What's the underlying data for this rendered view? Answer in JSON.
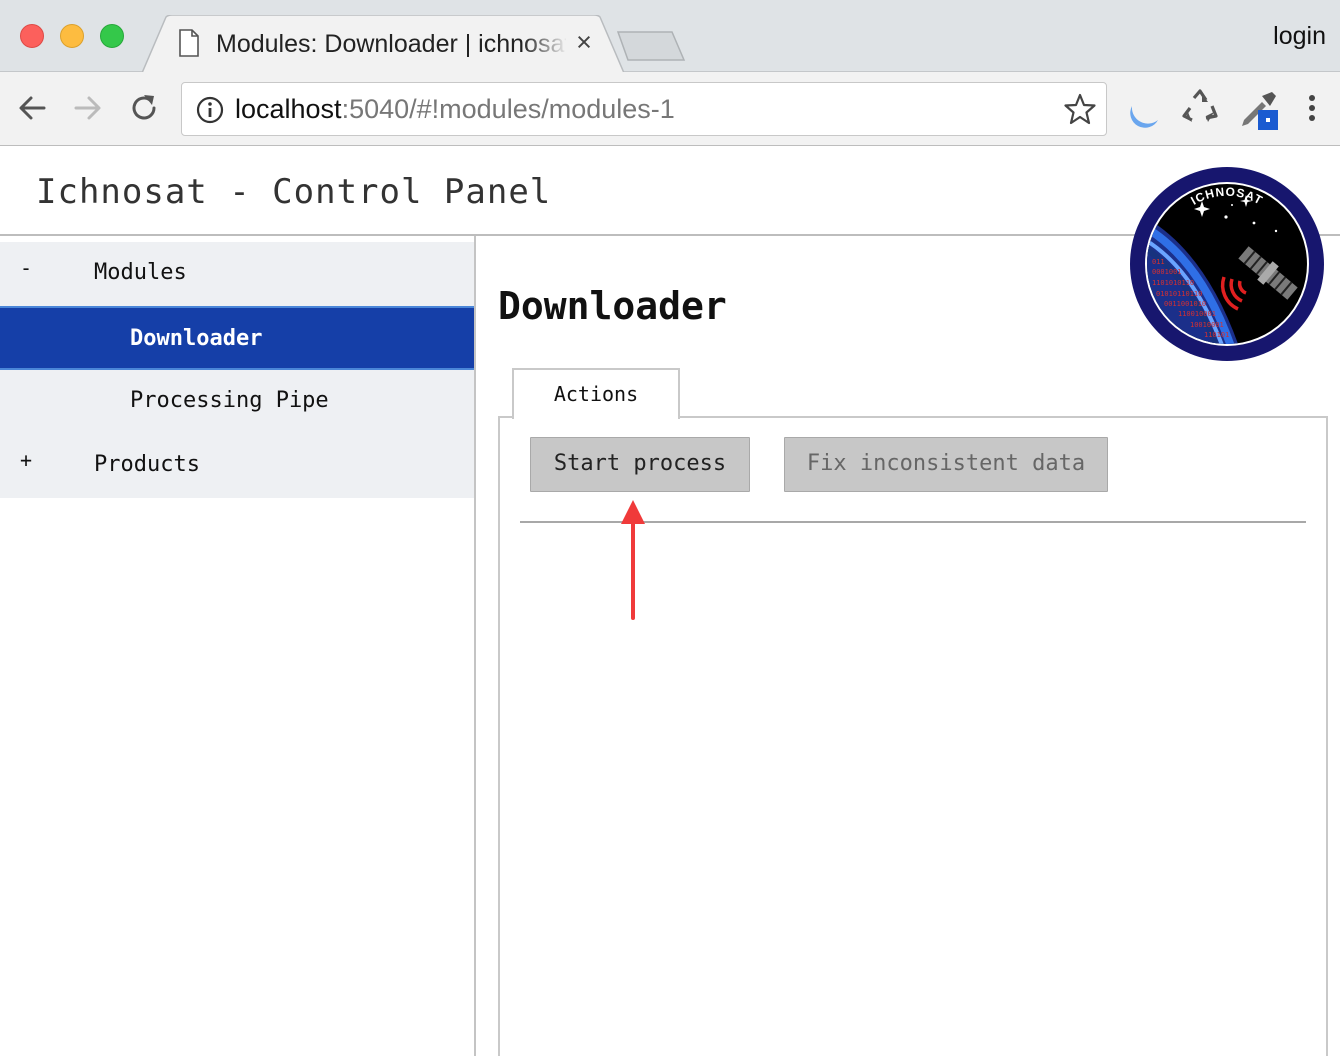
{
  "browser": {
    "tab_title": "Modules: Downloader | ichnosat",
    "close_glyph": "×",
    "login_label": "login",
    "url_host": "localhost",
    "url_rest": ":5040/#!modules/modules-1"
  },
  "app": {
    "title": "Ichnosat - Control Panel",
    "logo_text": "ICHNOSAT",
    "logo_binary": [
      "011",
      "0001001",
      "1101010110",
      "01010110110",
      "0011001010",
      "110010001",
      "10010001",
      "110101"
    ]
  },
  "sidebar": {
    "items": [
      {
        "toggle": "-",
        "label": "Modules",
        "level": "group",
        "selected": false
      },
      {
        "toggle": "",
        "label": "Downloader",
        "level": "child",
        "selected": true
      },
      {
        "toggle": "",
        "label": "Processing Pipe",
        "level": "child",
        "selected": false
      },
      {
        "toggle": "+",
        "label": "Products",
        "level": "group",
        "selected": false
      }
    ]
  },
  "main": {
    "page_title": "Downloader",
    "tabs": [
      {
        "label": "Actions",
        "active": true
      }
    ],
    "buttons": {
      "start_process": "Start process",
      "fix_inconsistent": "Fix inconsistent data"
    }
  },
  "colors": {
    "selected_item": "#153fa8",
    "sidebar_bg": "#eef0f3",
    "button_bg": "#c7c7c7",
    "annotation_arrow": "#f03a3a"
  },
  "icons": [
    "page-icon",
    "back-arrow-icon",
    "forward-arrow-icon",
    "reload-icon",
    "info-icon",
    "star-icon",
    "moon-extension-icon",
    "recycle-extension-icon",
    "eyedropper-extension-icon",
    "menu-dots-icon"
  ]
}
